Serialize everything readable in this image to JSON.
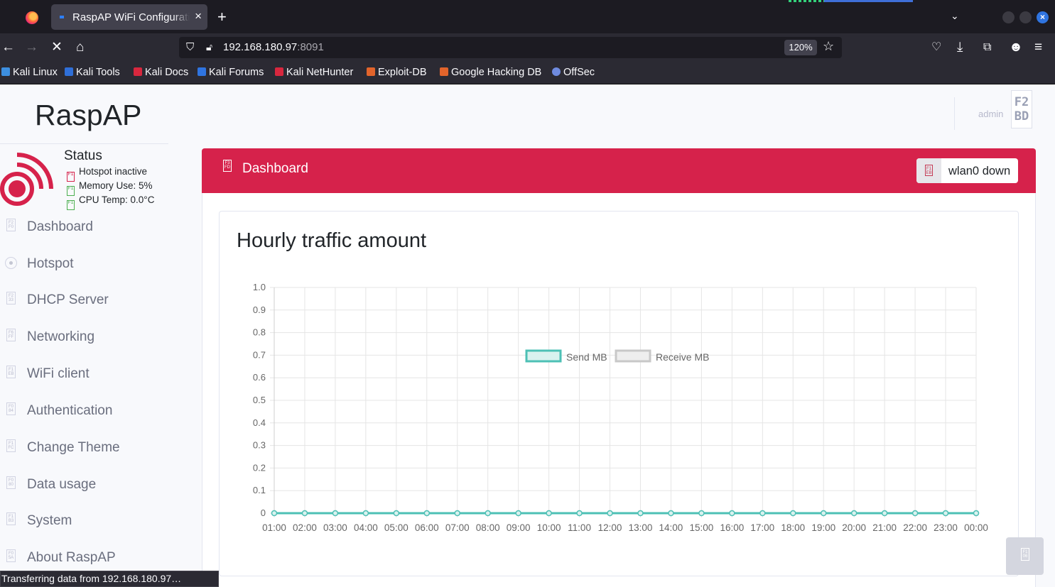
{
  "browser": {
    "tab_title": "RaspAP WiFi Configuration Portal",
    "url_host": "192.168.180.97",
    "url_port": ":8091",
    "zoom": "120%",
    "status_text": "Transferring data from 192.168.180.97…",
    "bookmarks": [
      {
        "label": "Kali Linux",
        "color": "#3d8fe0"
      },
      {
        "label": "Kali Tools",
        "color": "#2f6fd8"
      },
      {
        "label": "Kali Docs",
        "color": "#d8273e"
      },
      {
        "label": "Kali Forums",
        "color": "#2f74e0"
      },
      {
        "label": "Kali NetHunter",
        "color": "#d8273e"
      },
      {
        "label": "Exploit-DB",
        "color": "#e2642b"
      },
      {
        "label": "Google Hacking DB",
        "color": "#e2642b"
      },
      {
        "label": "OffSec",
        "color": "#6f8bdf"
      }
    ]
  },
  "app": {
    "brand": "RaspAP",
    "user": "admin",
    "avatar_text": "F2\nBD",
    "accent_color": "#d6224b"
  },
  "status": {
    "title": "Status",
    "hotspot": "Hotspot inactive",
    "memory": "Memory Use: 5%",
    "cpu": "CPU Temp: 0.0°C",
    "hotspot_color": "#d6224b",
    "ok_color": "#4caf50"
  },
  "sidebar": {
    "items": [
      {
        "label": "Dashboard"
      },
      {
        "label": "Hotspot"
      },
      {
        "label": "DHCP Server"
      },
      {
        "label": "Networking"
      },
      {
        "label": "WiFi client"
      },
      {
        "label": "Authentication"
      },
      {
        "label": "Change Theme"
      },
      {
        "label": "Data usage"
      },
      {
        "label": "System"
      },
      {
        "label": "About RaspAP"
      }
    ]
  },
  "dashboard": {
    "title": "Dashboard",
    "interface_button": "wlan0 down"
  },
  "chart_data": {
    "type": "line",
    "title": "Hourly traffic amount",
    "categories": [
      "01:00",
      "02:00",
      "03:00",
      "04:00",
      "05:00",
      "06:00",
      "07:00",
      "08:00",
      "09:00",
      "10:00",
      "11:00",
      "12:00",
      "13:00",
      "14:00",
      "15:00",
      "16:00",
      "17:00",
      "18:00",
      "19:00",
      "20:00",
      "21:00",
      "22:00",
      "23:00",
      "00:00"
    ],
    "series": [
      {
        "name": "Send MB",
        "values": [
          0,
          0,
          0,
          0,
          0,
          0,
          0,
          0,
          0,
          0,
          0,
          0,
          0,
          0,
          0,
          0,
          0,
          0,
          0,
          0,
          0,
          0,
          0,
          0
        ],
        "color": "#4dc0b5",
        "fill": "#d9f2ef"
      },
      {
        "name": "Receive MB",
        "values": [
          0,
          0,
          0,
          0,
          0,
          0,
          0,
          0,
          0,
          0,
          0,
          0,
          0,
          0,
          0,
          0,
          0,
          0,
          0,
          0,
          0,
          0,
          0,
          0
        ],
        "color": "#c8c8c8",
        "fill": "#eeeeee"
      }
    ],
    "y_ticks": [
      "1.0",
      "0.9",
      "0.8",
      "0.7",
      "0.6",
      "0.5",
      "0.4",
      "0.3",
      "0.2",
      "0.1",
      "0"
    ],
    "ylim": [
      0,
      1
    ],
    "legend": "top-center",
    "grid": true
  }
}
